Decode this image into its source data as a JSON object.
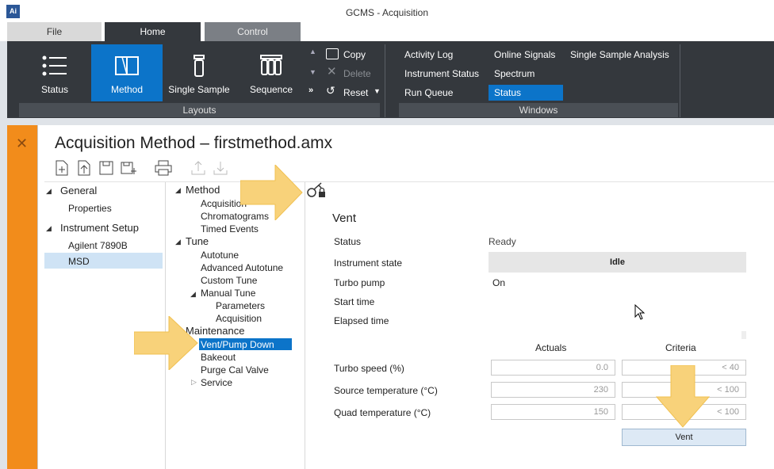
{
  "window": {
    "title": "GCMS - Acquisition",
    "logo_text": "Ai"
  },
  "tabs": [
    {
      "label": "File"
    },
    {
      "label": "Home"
    },
    {
      "label": "Control"
    }
  ],
  "ribbon": {
    "layouts": {
      "group_label": "Layouts",
      "buttons": [
        {
          "label": "Status",
          "icon": "list-icon"
        },
        {
          "label": "Method",
          "icon": "book-icon"
        },
        {
          "label": "Single Sample",
          "icon": "vial-icon"
        },
        {
          "label": "Sequence",
          "icon": "vials-icon"
        }
      ],
      "actions": [
        {
          "label": "Copy",
          "icon": "copy-icon"
        },
        {
          "label": "Delete",
          "icon": "close-icon"
        },
        {
          "label": "Reset",
          "icon": "undo-icon"
        }
      ]
    },
    "windows": {
      "group_label": "Windows",
      "items": [
        "Activity Log",
        "Instrument Status",
        "Run Queue",
        "Online Signals",
        "Spectrum",
        "Status",
        "Single Sample Analysis"
      ]
    }
  },
  "page": {
    "title": "Acquisition Method – firstmethod.amx"
  },
  "left_nav": {
    "general": {
      "label": "General",
      "children": [
        "Properties"
      ]
    },
    "instrument_setup": {
      "label": "Instrument Setup",
      "children": [
        "Agilent 7890B",
        "MSD"
      ]
    }
  },
  "method_tree": {
    "method": {
      "label": "Method",
      "children": [
        "Acquisition",
        "Chromatograms",
        "Timed Events"
      ]
    },
    "tune": {
      "label": "Tune",
      "children": [
        "Autotune",
        "Advanced Autotune",
        "Custom Tune"
      ],
      "manual_tune": {
        "label": "Manual Tune",
        "children": [
          "Parameters",
          "Acquisition"
        ]
      }
    },
    "maintenance": {
      "label": "Maintenance",
      "children": [
        "Vent/Pump Down",
        "Bakeout",
        "Purge Cal Valve",
        "Service"
      ]
    }
  },
  "vent": {
    "heading": "Vent",
    "status_label": "Status",
    "status_value": "Ready",
    "instrument_state_label": "Instrument state",
    "instrument_state_value": "Idle",
    "turbo_pump_label": "Turbo pump",
    "turbo_pump_value": "On",
    "start_time_label": "Start time",
    "elapsed_time_label": "Elapsed time",
    "actuals_header": "Actuals",
    "criteria_header": "Criteria",
    "rows": [
      {
        "label": "Turbo speed (%)",
        "actual": "0.0",
        "criteria": "< 40"
      },
      {
        "label": "Source temperature (°C)",
        "actual": "230",
        "criteria": "< 100"
      },
      {
        "label": "Quad temperature (°C)",
        "actual": "150",
        "criteria": "< 100"
      }
    ],
    "vent_button": "Vent"
  },
  "colors": {
    "accent": "#0c74c9",
    "ribbon": "#34383d",
    "orange_bar": "#f28c1b",
    "callout_arrow": "#f8d27a"
  }
}
